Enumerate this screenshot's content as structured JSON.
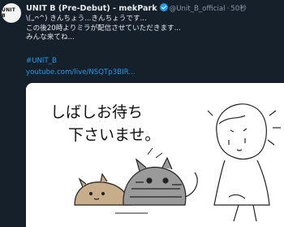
{
  "tweet": {
    "avatar_text": "UNIT B",
    "display_name": "UNIT B (Pre-Debut) - mekPark",
    "handle": "@Unit_B_official",
    "separator": "·",
    "time": "50秒",
    "verified_icon": "verified-badge-icon",
    "lines": [
      "\\(„ᴖ^) きんちょう...きんちょうです...",
      "この後20時よりミラが配信させていただきます...",
      "みんな来てね..."
    ],
    "hashtag": "#UNIT_B",
    "link": "youtube.com/live/NSQTp3BIR..."
  },
  "media": {
    "drawing_text_line1": "しばしお待ち",
    "drawing_text_line2": "下さいませ。"
  }
}
